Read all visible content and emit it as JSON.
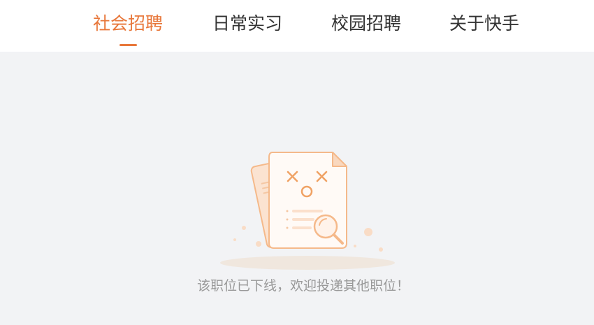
{
  "nav": {
    "tabs": [
      {
        "label": "社会招聘",
        "active": true
      },
      {
        "label": "日常实习",
        "active": false
      },
      {
        "label": "校园招聘",
        "active": false
      },
      {
        "label": "关于快手",
        "active": false
      }
    ]
  },
  "empty_state": {
    "icon": "offline-document-icon",
    "message": "该职位已下线，欢迎投递其他职位！"
  },
  "colors": {
    "accent": "#e8773a",
    "illustration": "#f5b98a",
    "background": "#f2f3f5"
  }
}
